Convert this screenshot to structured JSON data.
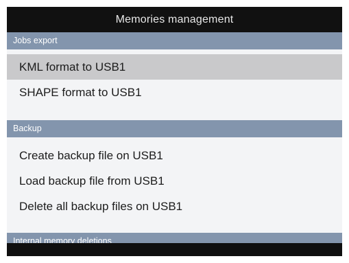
{
  "title": "Memories management",
  "sections": [
    {
      "header": "Jobs export",
      "items": [
        {
          "label": "KML format to USB1",
          "selected": true
        },
        {
          "label": "SHAPE format to USB1",
          "selected": false
        }
      ]
    },
    {
      "header": "Backup",
      "items": [
        {
          "label": "Create backup file on USB1",
          "selected": false
        },
        {
          "label": "Load backup file from USB1",
          "selected": false
        },
        {
          "label": "Delete all backup files on USB1",
          "selected": false
        }
      ]
    },
    {
      "header": "Internal memory deletions",
      "items": []
    }
  ],
  "colors": {
    "title_bar": "#111111",
    "section_header": "#8395ad",
    "selected_row": "#c9c9cb",
    "list_background": "#f3f4f6"
  }
}
